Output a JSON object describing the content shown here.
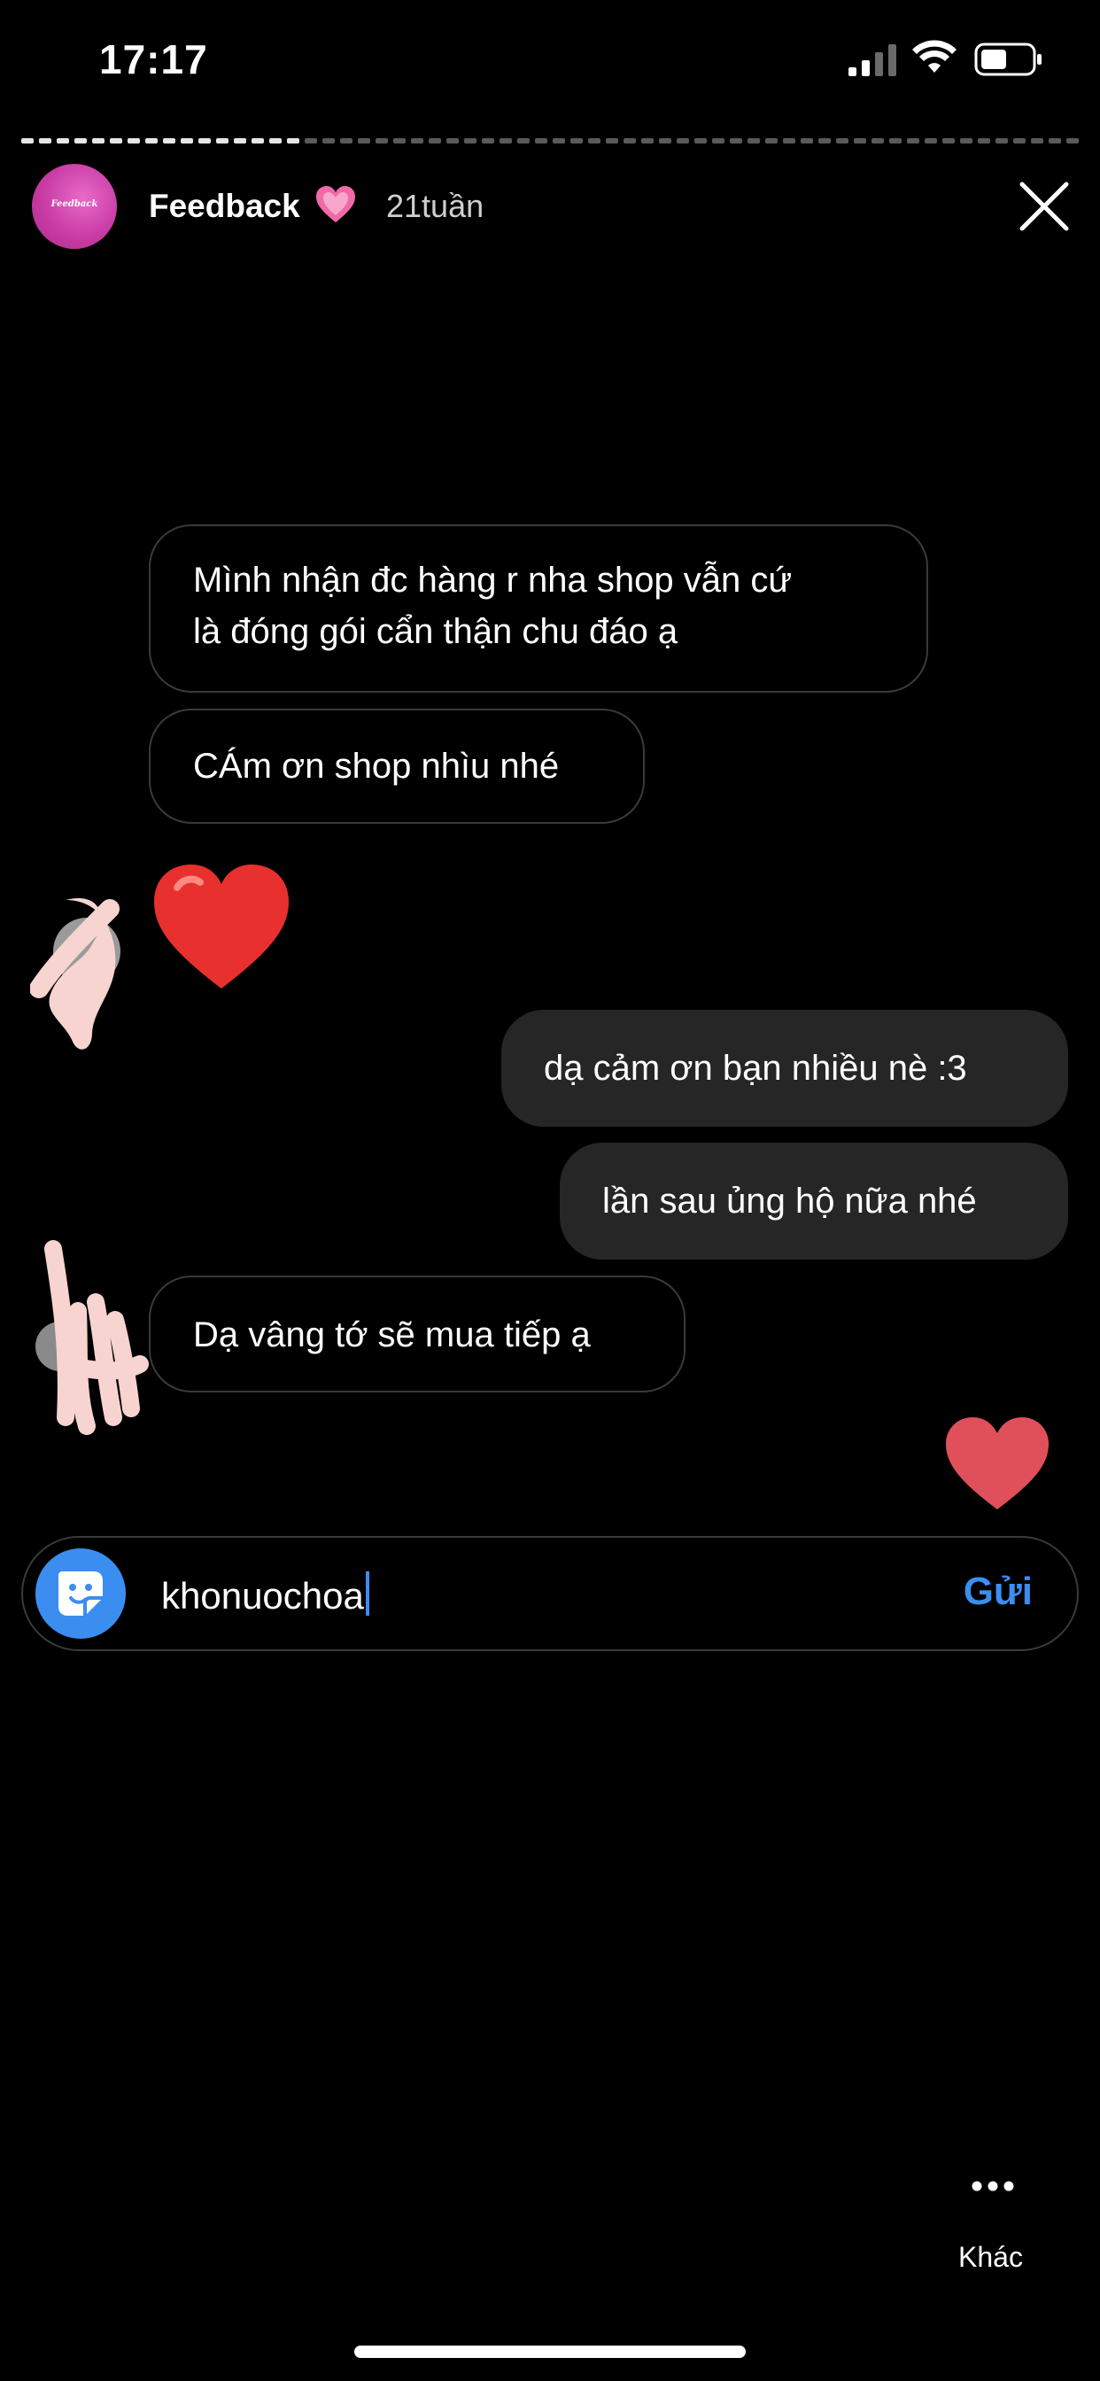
{
  "status_bar": {
    "time": "17:17"
  },
  "story": {
    "title": "Feedback",
    "title_emoji": "💗",
    "time": "21tuần",
    "avatar_text": "Feedback"
  },
  "messages": [
    {
      "text_line1": "Mình nhận đc hàng r nha shop vẫn cứ",
      "text_line2": "là đóng gói cẩn thận chu đáo ạ"
    },
    {
      "text": "CÁm ơn shop nhìu nhé"
    },
    {
      "text": "dạ cảm ơn bạn nhiều nè :3"
    },
    {
      "text": "lần sau ủng hộ nữa nhé"
    },
    {
      "text": "Dạ vâng tớ sẽ mua tiếp ạ"
    }
  ],
  "reply": {
    "input_value": "khonuochoa",
    "send_label": "Gửi"
  },
  "more": {
    "label": "Khác"
  },
  "colors": {
    "accent": "#3b8ef0",
    "bubble_dark": "#262626",
    "bubble_border": "#3a3a3a",
    "heart_red": "#e0505a"
  }
}
